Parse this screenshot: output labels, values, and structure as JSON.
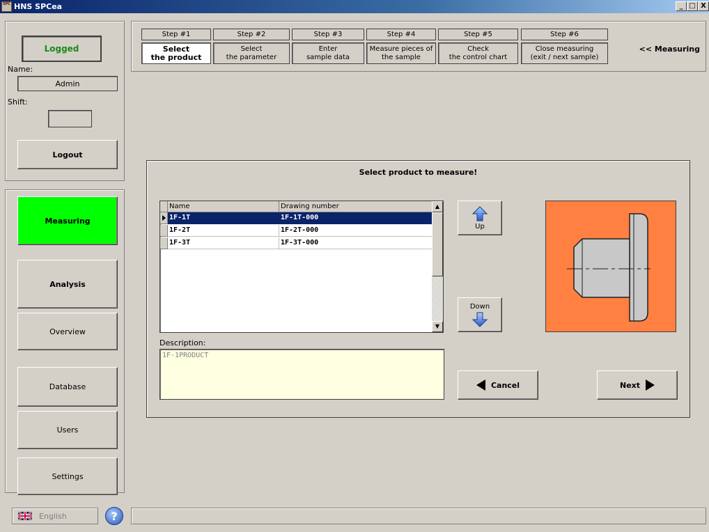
{
  "window": {
    "title": "HNS SPCea",
    "icon_text": "SPC",
    "minimize": "_",
    "maximize": "□",
    "close": "X"
  },
  "user": {
    "status": "Logged",
    "name_label": "Name:",
    "name_value": "Admin",
    "shift_label": "Shift:",
    "shift_value": "",
    "logout_label": "Logout"
  },
  "nav": {
    "measuring": "Measuring",
    "analysis": "Analysis",
    "overview": "Overview",
    "database": "Database",
    "users": "Users",
    "settings": "Settings"
  },
  "steps": [
    {
      "head": "Step #1",
      "line1": "Select",
      "line2": "the product",
      "active": true
    },
    {
      "head": "Step #2",
      "line1": "Select",
      "line2": "the parameter",
      "active": false
    },
    {
      "head": "Step #3",
      "line1": "Enter",
      "line2": "sample data",
      "active": false
    },
    {
      "head": "Step #4",
      "line1": "Measure pieces of",
      "line2": "the sample",
      "active": false
    },
    {
      "head": "Step #5",
      "line1": "Check",
      "line2": "the control chart",
      "active": false
    },
    {
      "head": "Step #6",
      "line1": "Close measuring",
      "line2": "(exit / next sample)",
      "active": false
    }
  ],
  "measuring_link": "<< Measuring",
  "main": {
    "title": "Select product to measure!",
    "columns": [
      "Name",
      "Drawing number"
    ],
    "rows": [
      {
        "name": "1F-1T",
        "drawing": "1F-1T-000",
        "selected": true
      },
      {
        "name": "1F-2T",
        "drawing": "1F-2T-000",
        "selected": false
      },
      {
        "name": "1F-3T",
        "drawing": "1F-3T-000",
        "selected": false
      }
    ],
    "description_label": "Description:",
    "description_value": "1F-1PRODUCT",
    "up_label": "Up",
    "down_label": "Down",
    "cancel_label": "Cancel",
    "next_label": "Next"
  },
  "footer": {
    "language": "English",
    "help_symbol": "?"
  },
  "colors": {
    "measuring_active": "#00ff00",
    "logged_text": "#1a8a1a",
    "product_bg": "#ff8040",
    "selection": "#0a246a",
    "description_bg": "#ffffe1"
  }
}
